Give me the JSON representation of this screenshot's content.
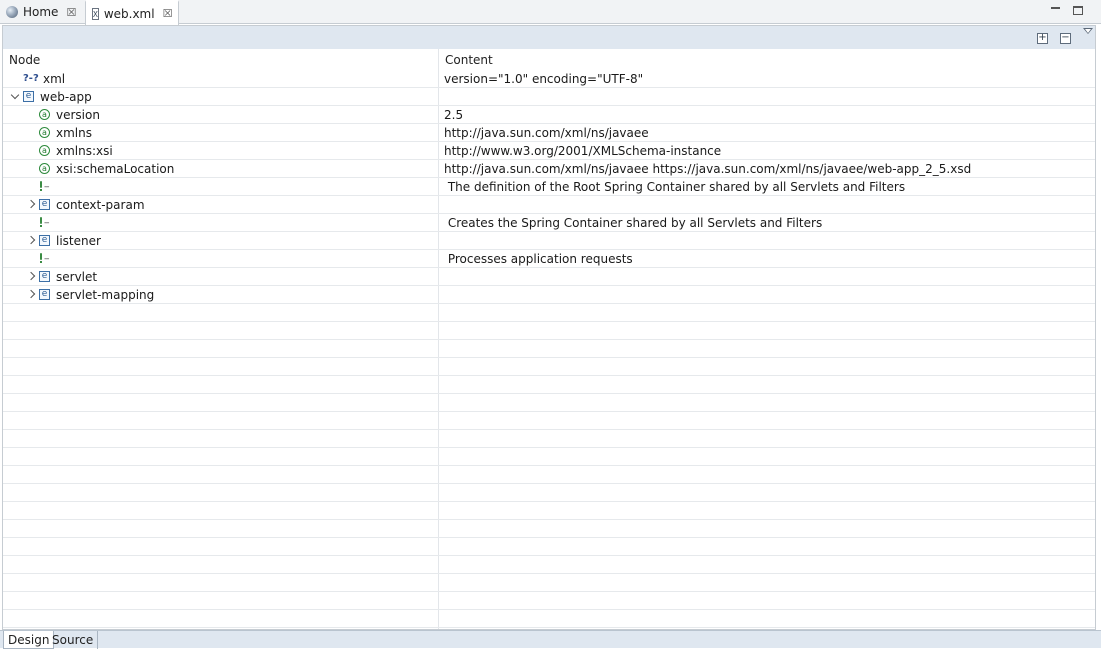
{
  "tabs": [
    {
      "label": "Home",
      "icon": "globe-icon",
      "close": "☒"
    },
    {
      "label": "web.xml",
      "icon": "xml-file-icon",
      "close": "☒"
    }
  ],
  "table": {
    "header_node": "Node",
    "header_content": "Content"
  },
  "rows": [
    {
      "kind": "pi",
      "indent": 0,
      "twisty": "none",
      "icon_text": "?-?",
      "label": "xml",
      "content": "version=\"1.0\" encoding=\"UTF-8\""
    },
    {
      "kind": "element",
      "indent": 0,
      "twisty": "expanded",
      "icon_text": "e",
      "label": "web-app",
      "content": ""
    },
    {
      "kind": "attribute",
      "indent": 1,
      "twisty": "none",
      "icon_text": "a",
      "label": "version",
      "content": "2.5"
    },
    {
      "kind": "attribute",
      "indent": 1,
      "twisty": "none",
      "icon_text": "a",
      "label": "xmlns",
      "content": "http://java.sun.com/xml/ns/javaee"
    },
    {
      "kind": "attribute",
      "indent": 1,
      "twisty": "none",
      "icon_text": "a",
      "label": "xmlns:xsi",
      "content": "http://www.w3.org/2001/XMLSchema-instance"
    },
    {
      "kind": "attribute",
      "indent": 1,
      "twisty": "none",
      "icon_text": "a",
      "label": "xsi:schemaLocation",
      "content": "http://java.sun.com/xml/ns/javaee https://java.sun.com/xml/ns/javaee/web-app_2_5.xsd"
    },
    {
      "kind": "comment",
      "indent": 1,
      "twisty": "none",
      "icon_text": "--",
      "label": "",
      "content": " The definition of the Root Spring Container shared by all Servlets and Filters"
    },
    {
      "kind": "element",
      "indent": 1,
      "twisty": "collapsed",
      "icon_text": "e",
      "label": "context-param",
      "content": ""
    },
    {
      "kind": "comment",
      "indent": 1,
      "twisty": "none",
      "icon_text": "--",
      "label": "",
      "content": " Creates the Spring Container shared by all Servlets and Filters"
    },
    {
      "kind": "element",
      "indent": 1,
      "twisty": "collapsed",
      "icon_text": "e",
      "label": "listener",
      "content": ""
    },
    {
      "kind": "comment",
      "indent": 1,
      "twisty": "none",
      "icon_text": "--",
      "label": "",
      "content": " Processes application requests"
    },
    {
      "kind": "element",
      "indent": 1,
      "twisty": "collapsed",
      "icon_text": "e",
      "label": "servlet",
      "content": ""
    },
    {
      "kind": "element",
      "indent": 1,
      "twisty": "collapsed",
      "icon_text": "e",
      "label": "servlet-mapping",
      "content": ""
    }
  ],
  "page_tabs": [
    "Design",
    "Source"
  ],
  "toolbar": {
    "expand_all_icon": "plus-box-icon",
    "collapse_all_icon": "minus-box-icon",
    "view_menu_icon": "chevron-down-icon"
  }
}
